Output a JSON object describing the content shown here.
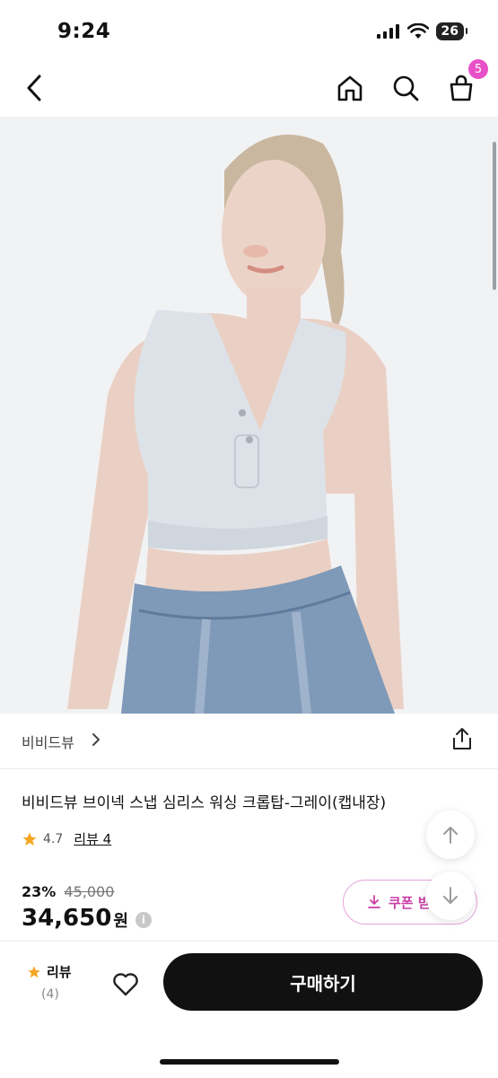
{
  "status_bar": {
    "time": "9:24",
    "battery": "26"
  },
  "nav": {
    "cart_count": "5"
  },
  "product": {
    "brand": "비비드뷰",
    "title": "비비드뷰 브이넥 스냅 심리스 워싱 크롭탑-그레이(캡내장)",
    "rating": "4.7",
    "review_label": "리뷰 4",
    "discount": "23%",
    "original_price": "45,000",
    "price": "34,650",
    "currency": "원",
    "coupon_label": "쿠폰 받",
    "info_icon": "i"
  },
  "bottom_bar": {
    "review_label": "리뷰",
    "review_count": "(4)",
    "buy_label": "구매하기"
  },
  "colors": {
    "accent": "#e850c7",
    "coupon_text": "#c93ea7",
    "star": "#f5a623",
    "buy_bg": "#111111"
  },
  "icons": [
    "back-icon",
    "home-icon",
    "search-icon",
    "cart-icon",
    "share-icon",
    "chevron-right-icon",
    "star-icon",
    "heart-icon",
    "arrow-up-icon",
    "arrow-down-icon",
    "download-icon"
  ]
}
